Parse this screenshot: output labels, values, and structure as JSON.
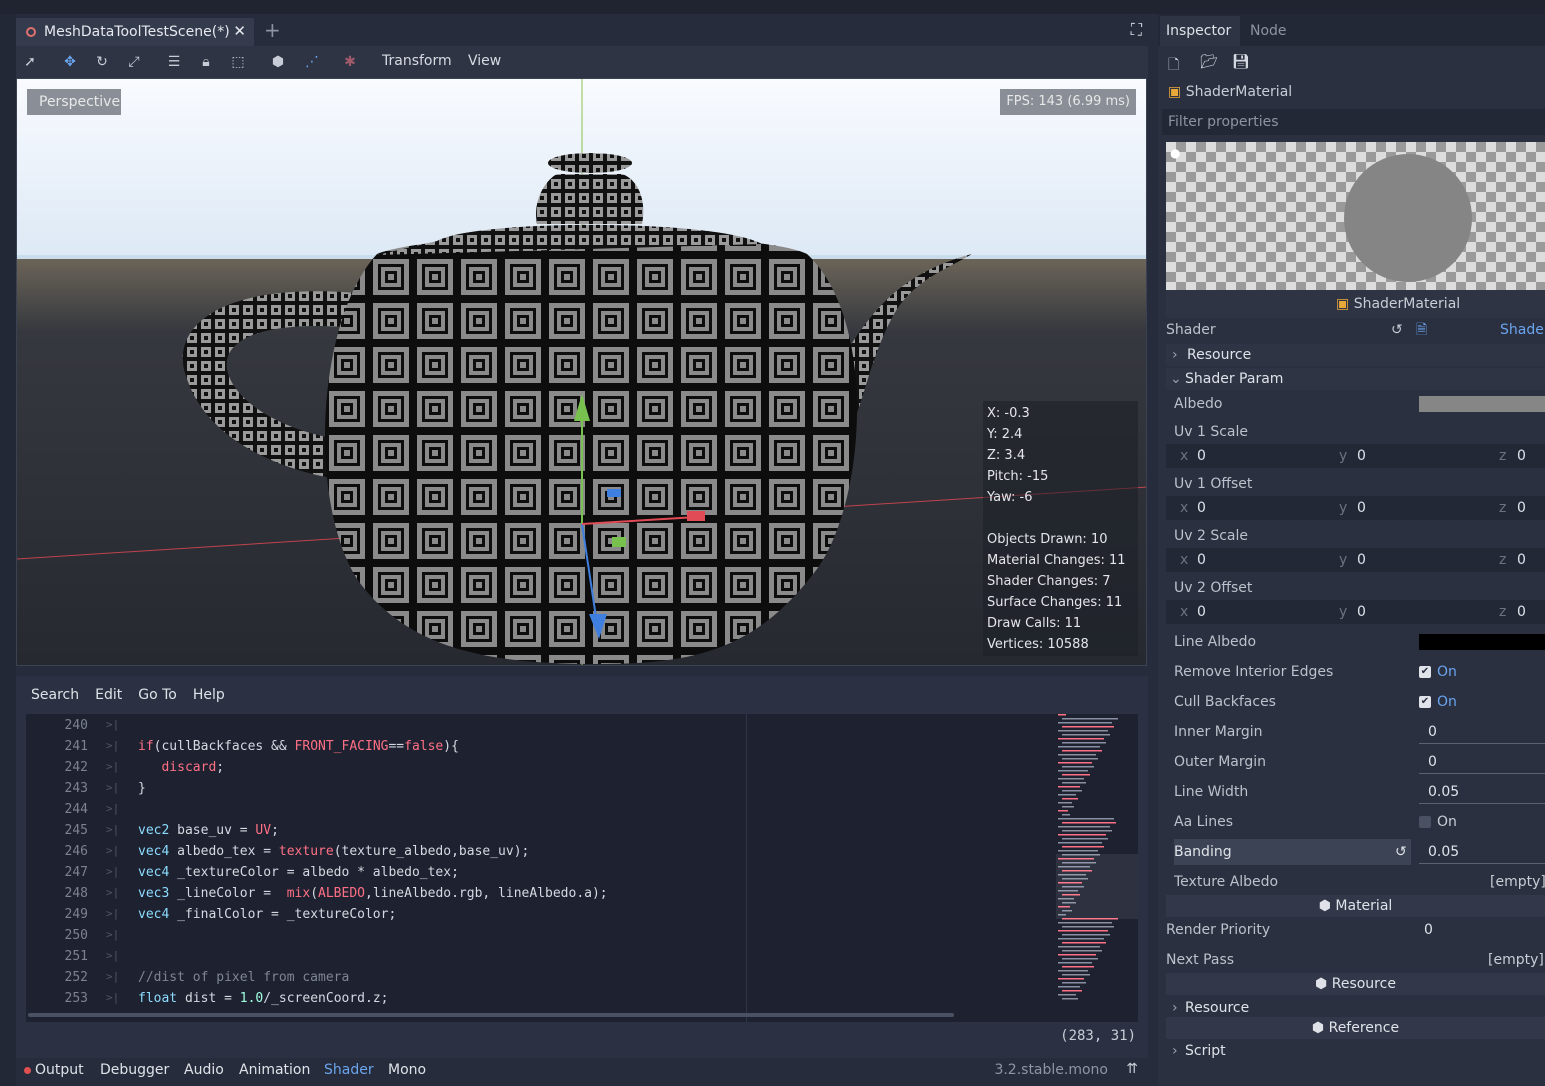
{
  "scene_tab": {
    "title": "MeshDataToolTestScene(*)",
    "close": "✕",
    "add": "+"
  },
  "toolbar": {
    "transform": "Transform",
    "view": "View"
  },
  "viewport": {
    "mode_label": "Perspective",
    "fps": "FPS: 143 (6.99 ms)",
    "stats": [
      "X: -0.3",
      "Y: 2.4",
      "Z: 3.4",
      "Pitch: -15",
      "Yaw: -6",
      "",
      "Objects Drawn: 10",
      "Material Changes: 11",
      "Shader Changes: 7",
      "Surface Changes: 11",
      "Draw Calls: 11",
      "Vertices: 10588"
    ]
  },
  "script_menu": [
    "Search",
    "Edit",
    "Go To",
    "Help"
  ],
  "code_lines": [
    {
      "n": "240",
      "html": ""
    },
    {
      "n": "241",
      "html": "<span class=\"kw\">if</span>(cullBackfaces &amp;&amp; <span class=\"fn\">FRONT_FACING</span>==<span class=\"kw\">false</span>){"
    },
    {
      "n": "242",
      "html": "   <span class=\"kw\">discard</span>;"
    },
    {
      "n": "243",
      "html": "}"
    },
    {
      "n": "244",
      "html": ""
    },
    {
      "n": "245",
      "html": "<span class=\"ty\">vec2</span> base_uv = <span class=\"fn\">UV</span>;"
    },
    {
      "n": "246",
      "html": "<span class=\"ty\">vec4</span> albedo_tex = <span class=\"fn\">texture</span>(texture_albedo,base_uv);"
    },
    {
      "n": "247",
      "html": "<span class=\"ty\">vec4</span> _textureColor = albedo * albedo_tex;"
    },
    {
      "n": "248",
      "html": "<span class=\"ty\">vec3</span> _lineColor =  <span class=\"fn\">mix</span>(<span class=\"fn\">ALBEDO</span>,lineAlbedo.rgb, lineAlbedo.a);"
    },
    {
      "n": "249",
      "html": "<span class=\"ty\">vec4</span> _finalColor = _textureColor;"
    },
    {
      "n": "250",
      "html": ""
    },
    {
      "n": "251",
      "html": ""
    },
    {
      "n": "252",
      "html": "<span class=\"cm\">//dist of pixel from camera</span>"
    },
    {
      "n": "253",
      "html": "<span class=\"ty\">float</span> dist = <span class=\"nm\">1.0</span>/_screenCoord.z;"
    }
  ],
  "cursor_pos": "(283, 31)",
  "bottom_tabs": {
    "output": "Output",
    "debugger": "Debugger",
    "audio": "Audio",
    "animation": "Animation",
    "shader": "Shader",
    "mono": "Mono"
  },
  "version": "3.2.stable.mono",
  "inspector": {
    "tab_inspector": "Inspector",
    "tab_node": "Node",
    "resource_name": "ShaderMaterial",
    "filter_placeholder": "Filter properties",
    "preview_label": "ShaderMaterial",
    "shader_label": "Shader",
    "shader_value": "Shader",
    "resource_sect": "Resource",
    "shader_param": "Shader Param",
    "albedo": "Albedo",
    "uv1scale": "Uv 1 Scale",
    "uv1offset": "Uv 1 Offset",
    "uv2scale": "Uv 2 Scale",
    "uv2offset": "Uv 2 Offset",
    "vec_x": "x",
    "vec_y": "y",
    "vec_z": "z",
    "zero": "0",
    "line_albedo": "Line Albedo",
    "remove_interior": "Remove Interior Edges",
    "cull_backfaces": "Cull Backfaces",
    "on": "On",
    "inner_margin": "Inner Margin",
    "inner_margin_val": "0",
    "outer_margin": "Outer Margin",
    "outer_margin_val": "0",
    "line_width": "Line Width",
    "line_width_val": "0.05",
    "aa_lines": "Aa Lines",
    "banding": "Banding",
    "banding_val": "0.05",
    "texture_albedo": "Texture Albedo",
    "empty": "[empty]",
    "material_sect": "Material",
    "render_priority": "Render Priority",
    "render_priority_val": "0",
    "next_pass": "Next Pass",
    "resource_sect2": "Resource",
    "resource_row": "Resource",
    "reference_sect": "Reference",
    "script_row": "Script"
  },
  "colors": {
    "accent": "#6aa5ef",
    "panel": "#2a3040",
    "editor_bg": "#1d2130"
  }
}
